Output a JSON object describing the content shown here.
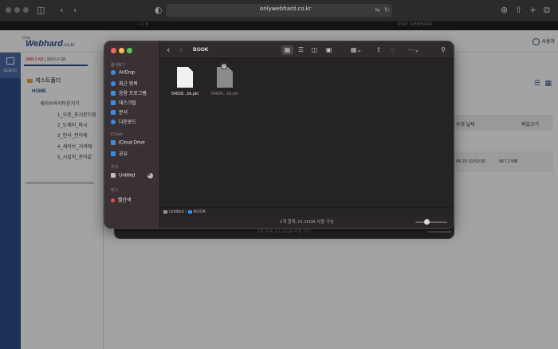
{
  "browser": {
    "url": "onlywebhard.co.kr",
    "tabs": [
      "• 1 B",
      "ONLY WEBHARD"
    ]
  },
  "webhard": {
    "logo_small": "Only",
    "logo": "Webhard",
    "logo_suffix": ".co.kr",
    "user_label": "사용자",
    "guest_label": "GUEST",
    "quota_used": "0MB 0 KB",
    "quota_total": "3000.0 GB",
    "folder_title": "게스트폴더",
    "tree": [
      "HOME",
      "세이브라이타운거기",
      "1_오른_포시운드링",
      "2_도레미_파시",
      "3_인사_전아에",
      "4_세이브_거색에",
      "5_시일의_관이같"
    ],
    "columns": [
      "수정 날짜",
      "파일크기"
    ],
    "row": {
      "date": "08.29 10:53:30",
      "size": "967.2 MB"
    }
  },
  "back_window": {
    "status": "2개 항목, 61.26GB 사용 가능"
  },
  "finder": {
    "folder_name": "BOOK",
    "sidebar": {
      "favorites_header": "즐겨찾기",
      "favorites": [
        "AirDrop",
        "최근 항목",
        "응용 프로그램",
        "데스크탑",
        "문서",
        "다운로드"
      ],
      "icloud_header": "iCloud",
      "icloud": [
        "iCloud Drive",
        "공유"
      ],
      "locations_header": "위치",
      "locations": [
        "Untitled"
      ],
      "tags_header": "태그",
      "tags": [
        "빨간색"
      ]
    },
    "files": [
      {
        "name": "54828...bk.pln",
        "state": "normal"
      },
      {
        "name": "54686...bk.pln",
        "state": "dimmed"
      }
    ],
    "path": [
      "Untitled",
      "BOOK"
    ],
    "status": "2개 항목, 61.26GB 사용 가능"
  }
}
